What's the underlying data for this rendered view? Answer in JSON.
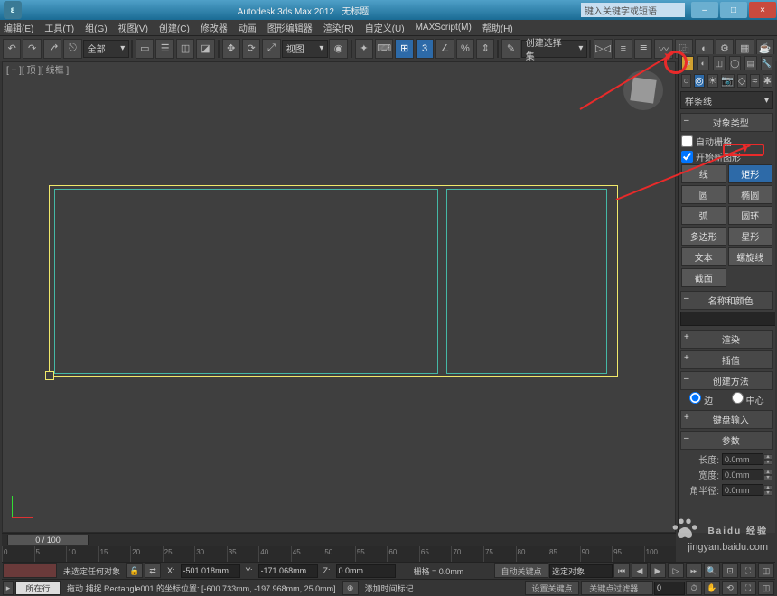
{
  "title": {
    "app": "Autodesk 3ds Max 2012",
    "doc": "无标题"
  },
  "search_placeholder": "键入关键字或短语",
  "winbtns": {
    "min": "–",
    "max": "□",
    "close": "×"
  },
  "menu": [
    "编辑(E)",
    "工具(T)",
    "组(G)",
    "视图(V)",
    "创建(C)",
    "修改器",
    "动画",
    "图形编辑器",
    "渲染(R)",
    "自定义(U)",
    "MAXScript(M)",
    "帮助(H)"
  ],
  "toolbar1": {
    "combo_all": "全部",
    "combo_view": "视图",
    "combo_create": "创建选择集",
    "btn3": "3"
  },
  "viewport_label": "[ + ][ 顶 ][ 线框 ]",
  "cmd": {
    "drop": "样条线",
    "roll_objtype": "对象类型",
    "autogrid": "自动栅格",
    "startnew": "开始新图形",
    "buttons": [
      [
        "线",
        "矩形"
      ],
      [
        "圆",
        "椭圆"
      ],
      [
        "弧",
        "圆环"
      ],
      [
        "多边形",
        "星形"
      ],
      [
        "文本",
        "螺旋线"
      ],
      [
        "截面",
        ""
      ]
    ],
    "roll_namecolor": "名称和颜色",
    "roll_render": "渲染",
    "roll_interp": "插值",
    "roll_method": "创建方法",
    "radio_edge": "边",
    "radio_center": "中心",
    "roll_keyboard": "键盘输入",
    "roll_params": "参数",
    "spin_length": "长度:",
    "spin_width": "宽度:",
    "spin_corner": "角半径:",
    "spin_val": "0.0mm"
  },
  "timeline": {
    "thumb": "0 / 100",
    "ticks": [
      "0",
      "5",
      "10",
      "15",
      "20",
      "25",
      "30",
      "35",
      "40",
      "45",
      "50",
      "55",
      "60",
      "65",
      "70",
      "75",
      "80",
      "85",
      "90",
      "95",
      "100"
    ]
  },
  "status": {
    "noselect": "未选定任何对象",
    "addtime": "添加时间标记",
    "grid": "栅格 = 0.0mm",
    "autokey": "自动关键点",
    "selfilter": "选定对象",
    "setkey": "设置关键点",
    "keyfilter": "关键点过滤器...",
    "xl": "X:",
    "yl": "Y:",
    "zl": "Z:",
    "xv": "-501.018mm",
    "yv": "-171.068mm",
    "zv": "0.0mm",
    "prompt": "拖动 捕捉 Rectangle001 的坐标位置:  [-600.733mm, -197.968mm, 25.0mm]",
    "row2label": "所在行"
  },
  "watermark": {
    "brand": "Baidu 经验",
    "url": "jingyan.baidu.com"
  }
}
